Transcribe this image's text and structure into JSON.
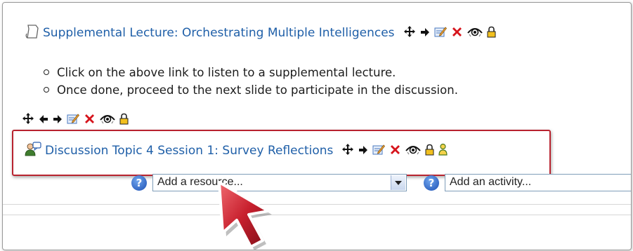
{
  "resource": {
    "title": "Supplemental Lecture: Orchestrating Multiple Intelligences",
    "icons": [
      "move-icon",
      "move-right-icon",
      "edit-icon",
      "delete-icon",
      "visibility-eye-icon",
      "lock-icon"
    ]
  },
  "label_block": {
    "bullets": [
      "Click on the above link to listen to a supplemental lecture.",
      "Once done, proceed to the next slide to participate in the discussion."
    ],
    "icons": [
      "move-icon",
      "move-left-icon",
      "move-right-icon",
      "edit-icon",
      "delete-icon",
      "visibility-eye-icon",
      "lock-icon"
    ]
  },
  "forum": {
    "title": "Discussion Topic 4 Session 1: Survey Reflections",
    "icons": [
      "move-icon",
      "move-right-icon",
      "edit-icon",
      "delete-icon",
      "visibility-eye-icon",
      "lock-icon",
      "groups-icon"
    ]
  },
  "controls": {
    "help_glyph": "?",
    "add_resource": "Add a resource...",
    "add_activity": "Add an activity..."
  },
  "colors": {
    "link": "#1f5fa8",
    "highlight_border": "#b8232f",
    "cursor": "#c8202e"
  }
}
